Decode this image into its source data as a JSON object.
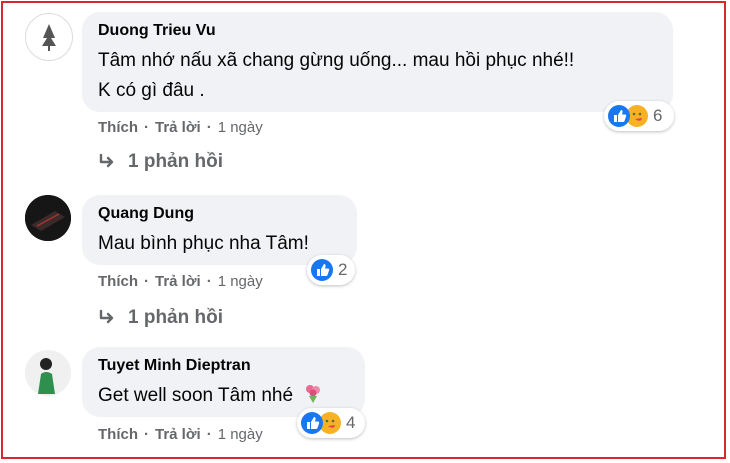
{
  "comments": [
    {
      "author": "Duong Trieu Vu",
      "lines": [
        "Tâm nhớ nấu xã chang gừng uống... mau hồi phục nhé!!",
        "K có gì đâu ."
      ],
      "actions": {
        "like": "Thích",
        "reply": "Trả lời",
        "time": "1 ngày"
      },
      "reactions": "6",
      "replies": "1 phản hồi"
    },
    {
      "author": "Quang Dung",
      "lines": [
        "Mau bình phục nha Tâm!"
      ],
      "actions": {
        "like": "Thích",
        "reply": "Trả lời",
        "time": "1 ngày"
      },
      "reactions": "2",
      "replies": "1 phản hồi"
    },
    {
      "author": "Tuyet Minh Dieptran",
      "lines": [
        "Get well soon Tâm nhé"
      ],
      "actions": {
        "like": "Thích",
        "reply": "Trả lời",
        "time": "1 ngày"
      },
      "reactions": "4"
    }
  ],
  "icons": {
    "like": "like-icon",
    "care": "care-icon",
    "reply_arrow": "reply-arrow-icon",
    "flower": "flower-emoji"
  },
  "colors": {
    "bubble": "#f0f2f5",
    "meta": "#65676b",
    "like": "#1877f2",
    "frame": "#d9272e"
  }
}
